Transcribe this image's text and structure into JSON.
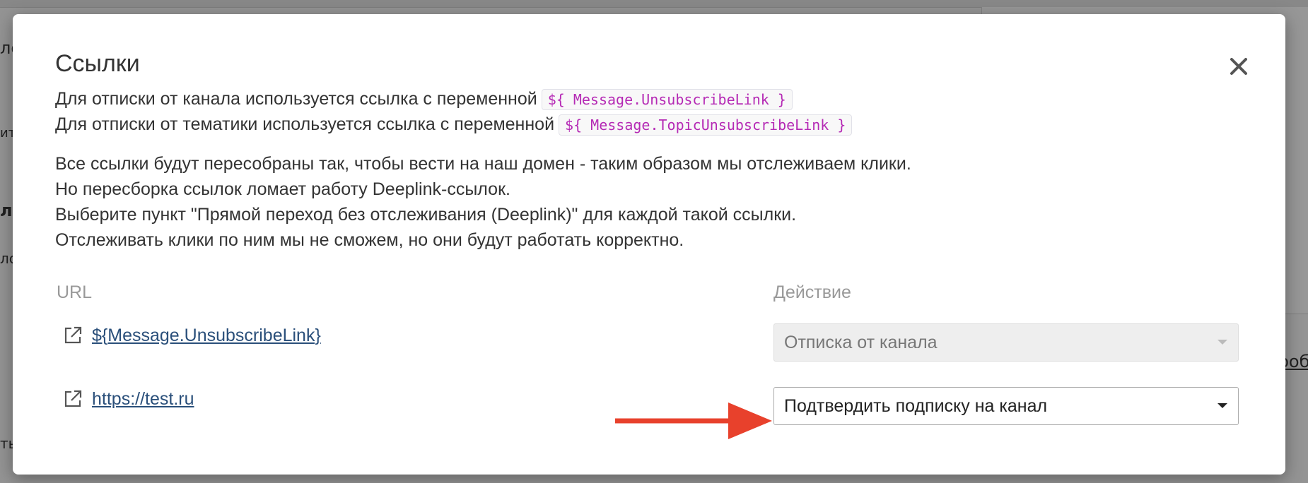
{
  "background": {
    "fragments": [
      "ло",
      "ит",
      "ль",
      "лс",
      "ть",
      "проб"
    ]
  },
  "modal": {
    "title": "Ссылки",
    "close_icon": "close-icon",
    "intro_lines": [
      {
        "text": "Для отписки от канала используется ссылка с переменной",
        "code": "${ Message.UnsubscribeLink }"
      },
      {
        "text": "Для отписки от тематики используется ссылка с переменной",
        "code": "${ Message.TopicUnsubscribeLink }"
      }
    ],
    "info_lines": [
      "Все ссылки будут пересобраны так, чтобы вести на наш домен - таким образом мы отслеживаем клики.",
      "Но пересборка ссылок ломает работу Deeplink-ссылок.",
      "Выберите пункт \"Прямой переход без отслеживания (Deeplink)\" для каждой такой ссылки.",
      "Отслеживать клики по ним мы не сможем, но они будут работать корректно."
    ],
    "table": {
      "col_url": "URL",
      "col_action": "Действие",
      "rows": [
        {
          "url": "${Message.UnsubscribeLink}",
          "action": "Отписка от канала",
          "disabled": true
        },
        {
          "url": "https://test.ru",
          "action": "Подтвердить подписку на канал",
          "disabled": false
        }
      ]
    }
  },
  "colors": {
    "code_text": "#b52ab5",
    "link": "#2a4f7a",
    "annotation_arrow": "#e8412c"
  },
  "icons": {
    "external_link": "external-link-icon",
    "dropdown": "caret-down-icon",
    "annotation": "red-arrow-annotation"
  }
}
